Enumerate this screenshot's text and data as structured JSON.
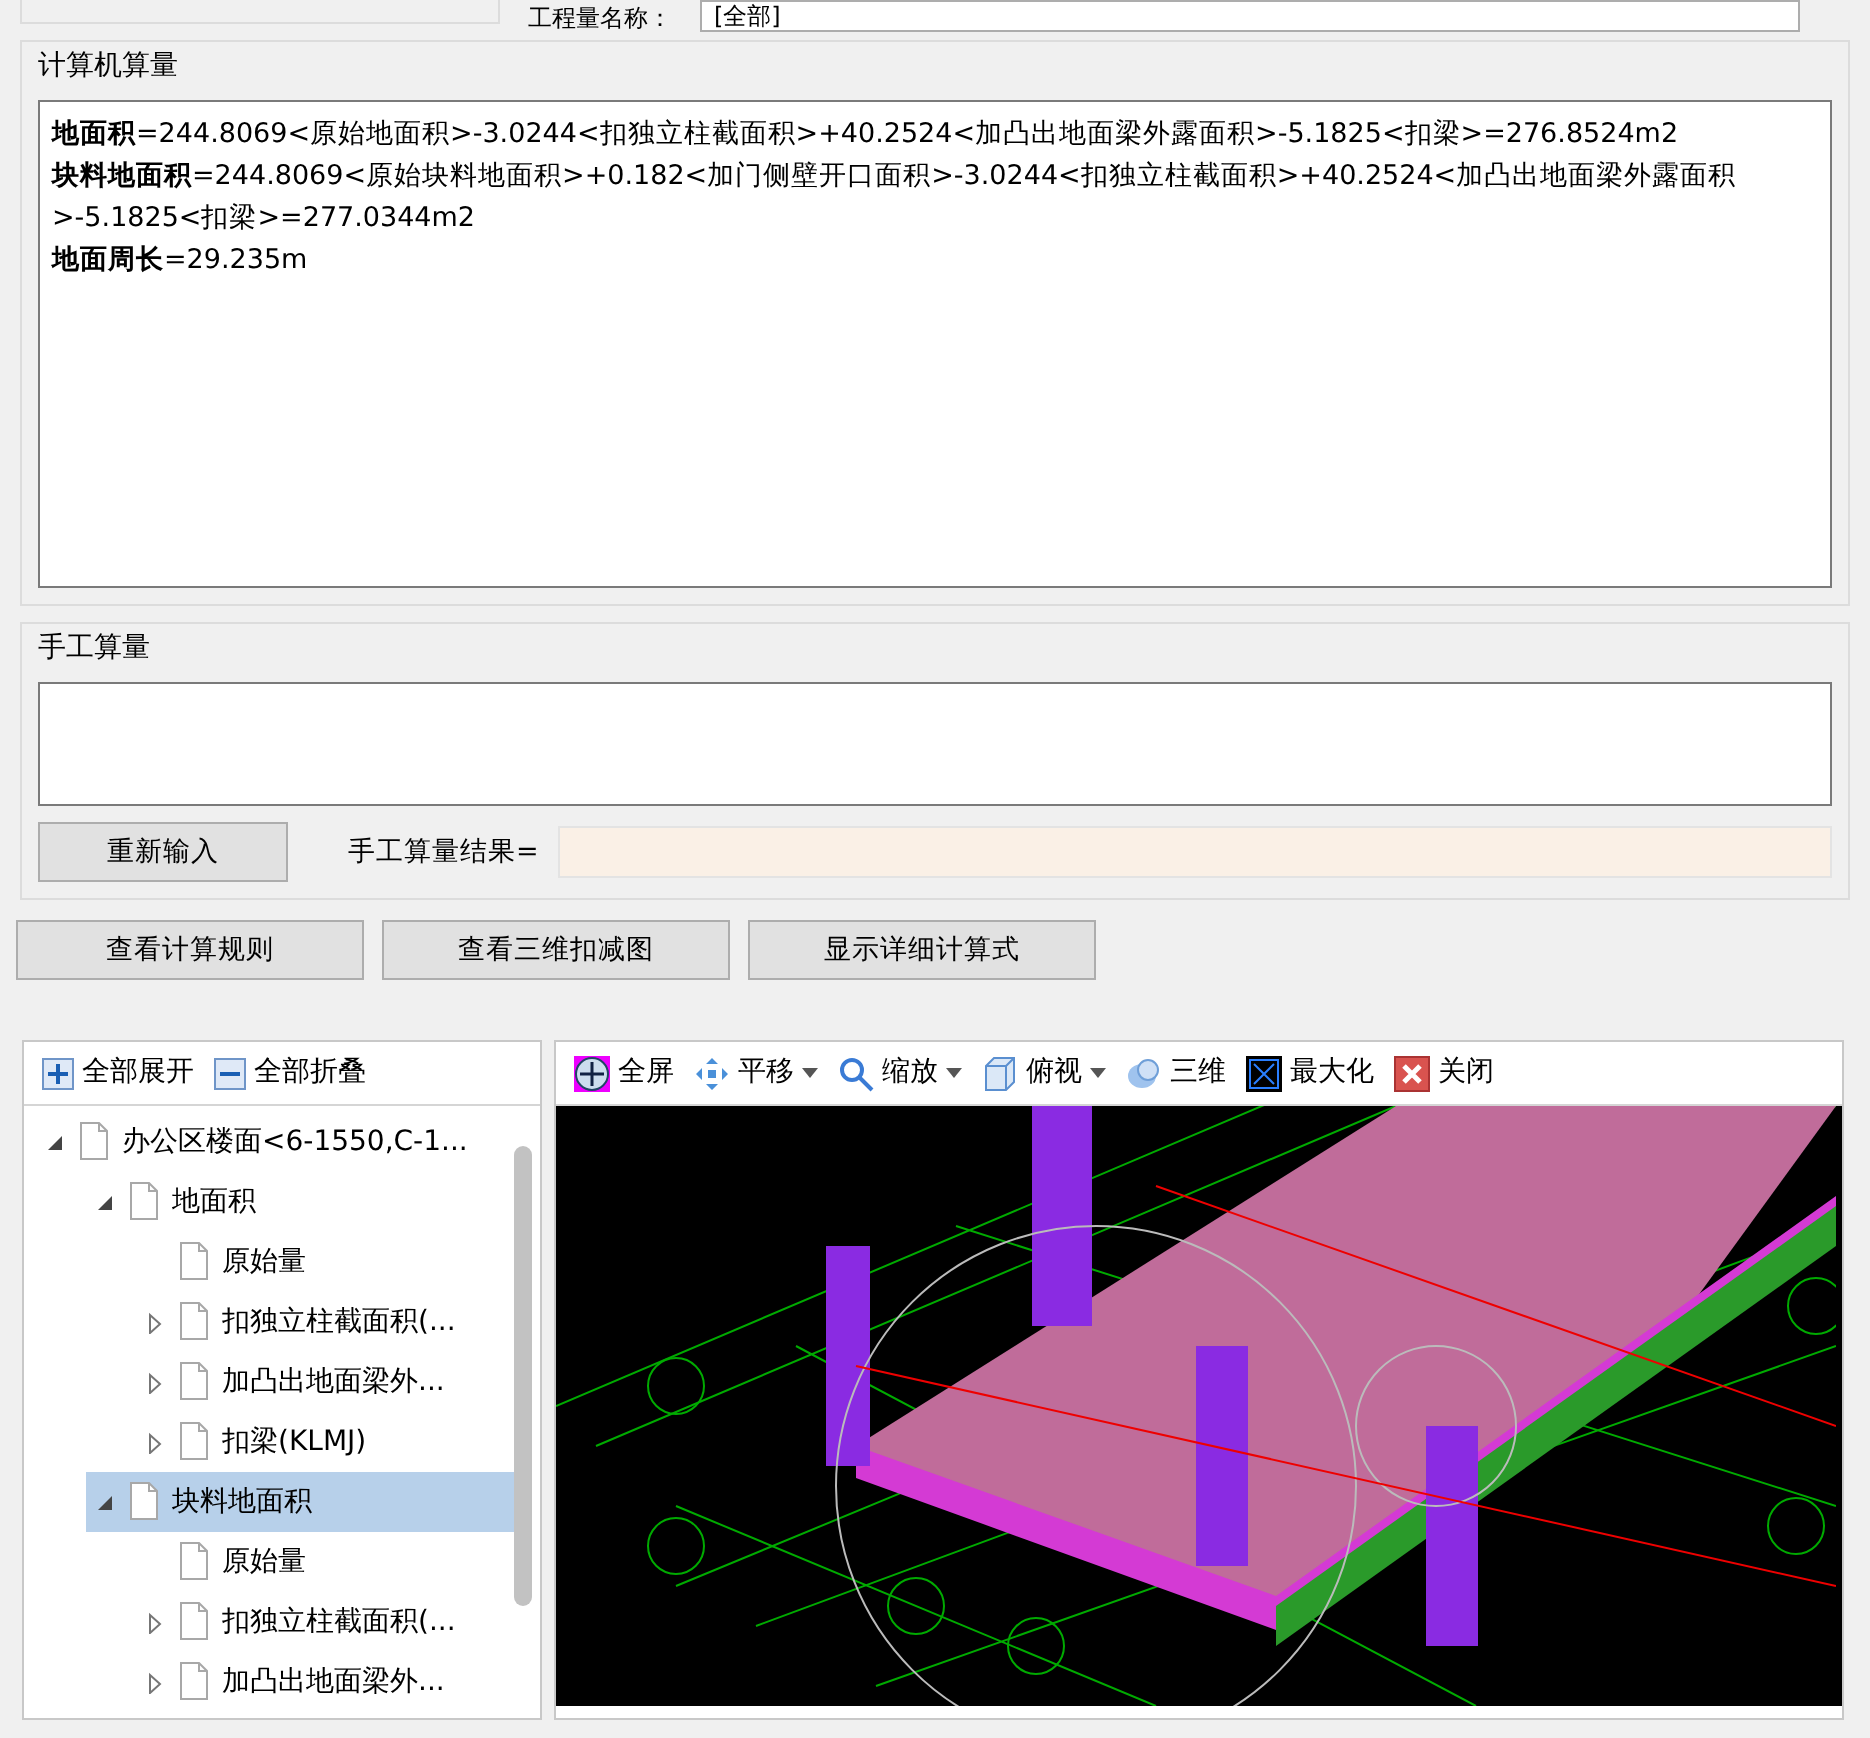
{
  "top_row": {
    "label": "工程量名称：",
    "value": "[全部]"
  },
  "computer_calc": {
    "title": "计算机算量",
    "lines": [
      "**地面积**=244.8069<原始地面积>-3.0244<扣独立柱截面积>+40.2524<加凸出地面梁外露面积>-5.1825<扣梁>=276.8524m2",
      "**块料地面积**=244.8069<原始块料地面积>+0.182<加门侧壁开口面积>-3.0244<扣独立柱截面积>+40.2524<加凸出地面梁外露面积>-5.1825<扣梁>=277.0344m2",
      "**地面周长**=29.235m"
    ]
  },
  "manual_calc": {
    "title": "手工算量",
    "reset_button": "重新输入",
    "result_label": "手工算量结果="
  },
  "buttons": [
    "查看计算规则",
    "查看三维扣减图",
    "显示详细计算式"
  ],
  "tree_toolbar": [
    {
      "kind": "expand",
      "label": "全部展开"
    },
    {
      "kind": "collapse",
      "label": "全部折叠"
    }
  ],
  "tree": [
    {
      "kind": "group",
      "label": "办公区楼面<6-1550,C-1...",
      "expanded": true,
      "selected": false,
      "children": [
        {
          "kind": "group",
          "label": "地面积",
          "expanded": true,
          "selected": false,
          "children": [
            {
              "kind": "leaf",
              "label": "原始量",
              "selected": false
            },
            {
              "kind": "group",
              "label": "扣独立柱截面积(...",
              "expanded": false,
              "selected": false
            },
            {
              "kind": "group",
              "label": "加凸出地面梁外...",
              "expanded": false,
              "selected": false
            },
            {
              "kind": "group",
              "label": "扣梁(KLMJ)",
              "expanded": false,
              "selected": false
            }
          ]
        },
        {
          "kind": "group",
          "label": "块料地面积",
          "expanded": true,
          "selected": true,
          "children": [
            {
              "kind": "leaf",
              "label": "原始量",
              "selected": false
            },
            {
              "kind": "group",
              "label": "扣独立柱截面积(...",
              "expanded": false,
              "selected": false
            },
            {
              "kind": "group",
              "label": "加凸出地面梁外...",
              "expanded": false,
              "selected": false
            }
          ]
        }
      ]
    }
  ],
  "viewer_toolbar": [
    {
      "kind": "fullscreen",
      "label": "全屏",
      "dropdown": false
    },
    {
      "kind": "pan",
      "label": "平移",
      "dropdown": true
    },
    {
      "kind": "zoom",
      "label": "缩放",
      "dropdown": true
    },
    {
      "kind": "view",
      "label": "俯视",
      "dropdown": true
    },
    {
      "kind": "orbit",
      "label": "三维",
      "dropdown": false
    },
    {
      "kind": "maximize",
      "label": "最大化",
      "dropdown": false
    },
    {
      "kind": "close",
      "label": "关闭",
      "dropdown": false
    }
  ]
}
